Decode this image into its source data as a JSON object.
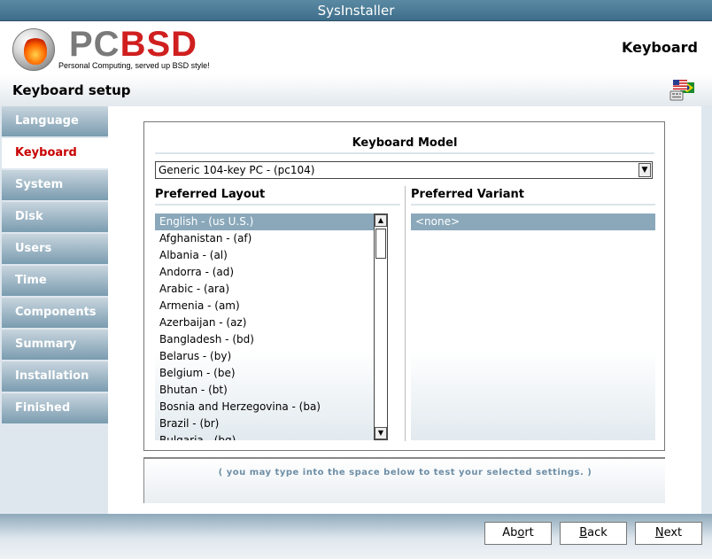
{
  "window": {
    "title": "SysInstaller"
  },
  "banner": {
    "logo_pc": "PC",
    "logo_bsd": "BSD",
    "tagline": "Personal Computing, served up BSD style!",
    "page_heading": "Keyboard"
  },
  "subheader": {
    "title": "Keyboard setup",
    "icon": "keyboard-flags-icon"
  },
  "sidebar": {
    "items": [
      {
        "label": "Language",
        "active": false
      },
      {
        "label": "Keyboard",
        "active": true
      },
      {
        "label": "System",
        "active": false
      },
      {
        "label": "Disk",
        "active": false
      },
      {
        "label": "Users",
        "active": false
      },
      {
        "label": "Time",
        "active": false
      },
      {
        "label": "Components",
        "active": false
      },
      {
        "label": "Summary",
        "active": false
      },
      {
        "label": "Installation",
        "active": false
      },
      {
        "label": "Finished",
        "active": false
      }
    ]
  },
  "keyboard_model": {
    "label": "Keyboard Model",
    "selected": "Generic 104-key PC - (pc104)"
  },
  "layout": {
    "label": "Preferred Layout",
    "items": [
      "English - (us U.S.)",
      "Afghanistan - (af)",
      "Albania - (al)",
      "Andorra - (ad)",
      "Arabic - (ara)",
      "Armenia - (am)",
      "Azerbaijan - (az)",
      "Bangladesh - (bd)",
      "Belarus - (by)",
      "Belgium - (be)",
      "Bhutan - (bt)",
      "Bosnia and Herzegovina - (ba)",
      "Brazil - (br)",
      "Bulgaria - (bg)"
    ],
    "selected_index": 0
  },
  "variant": {
    "label": "Preferred Variant",
    "items": [
      "<none>"
    ],
    "selected_index": 0
  },
  "test": {
    "hint": "( you may type into the space below to test your selected settings. )"
  },
  "buttons": {
    "abort": {
      "pre": "Ab",
      "key": "o",
      "post": "rt"
    },
    "back": {
      "pre": "",
      "key": "B",
      "post": "ack"
    },
    "next": {
      "pre": "",
      "key": "N",
      "post": "ext"
    }
  },
  "colors": {
    "accent_active": "#c80000",
    "sidebar_gradient_top": "#c8d5de",
    "sidebar_gradient_bottom": "#7a9cb0",
    "selection": "#8aa8ba",
    "titlebar": "#4a7b96"
  }
}
